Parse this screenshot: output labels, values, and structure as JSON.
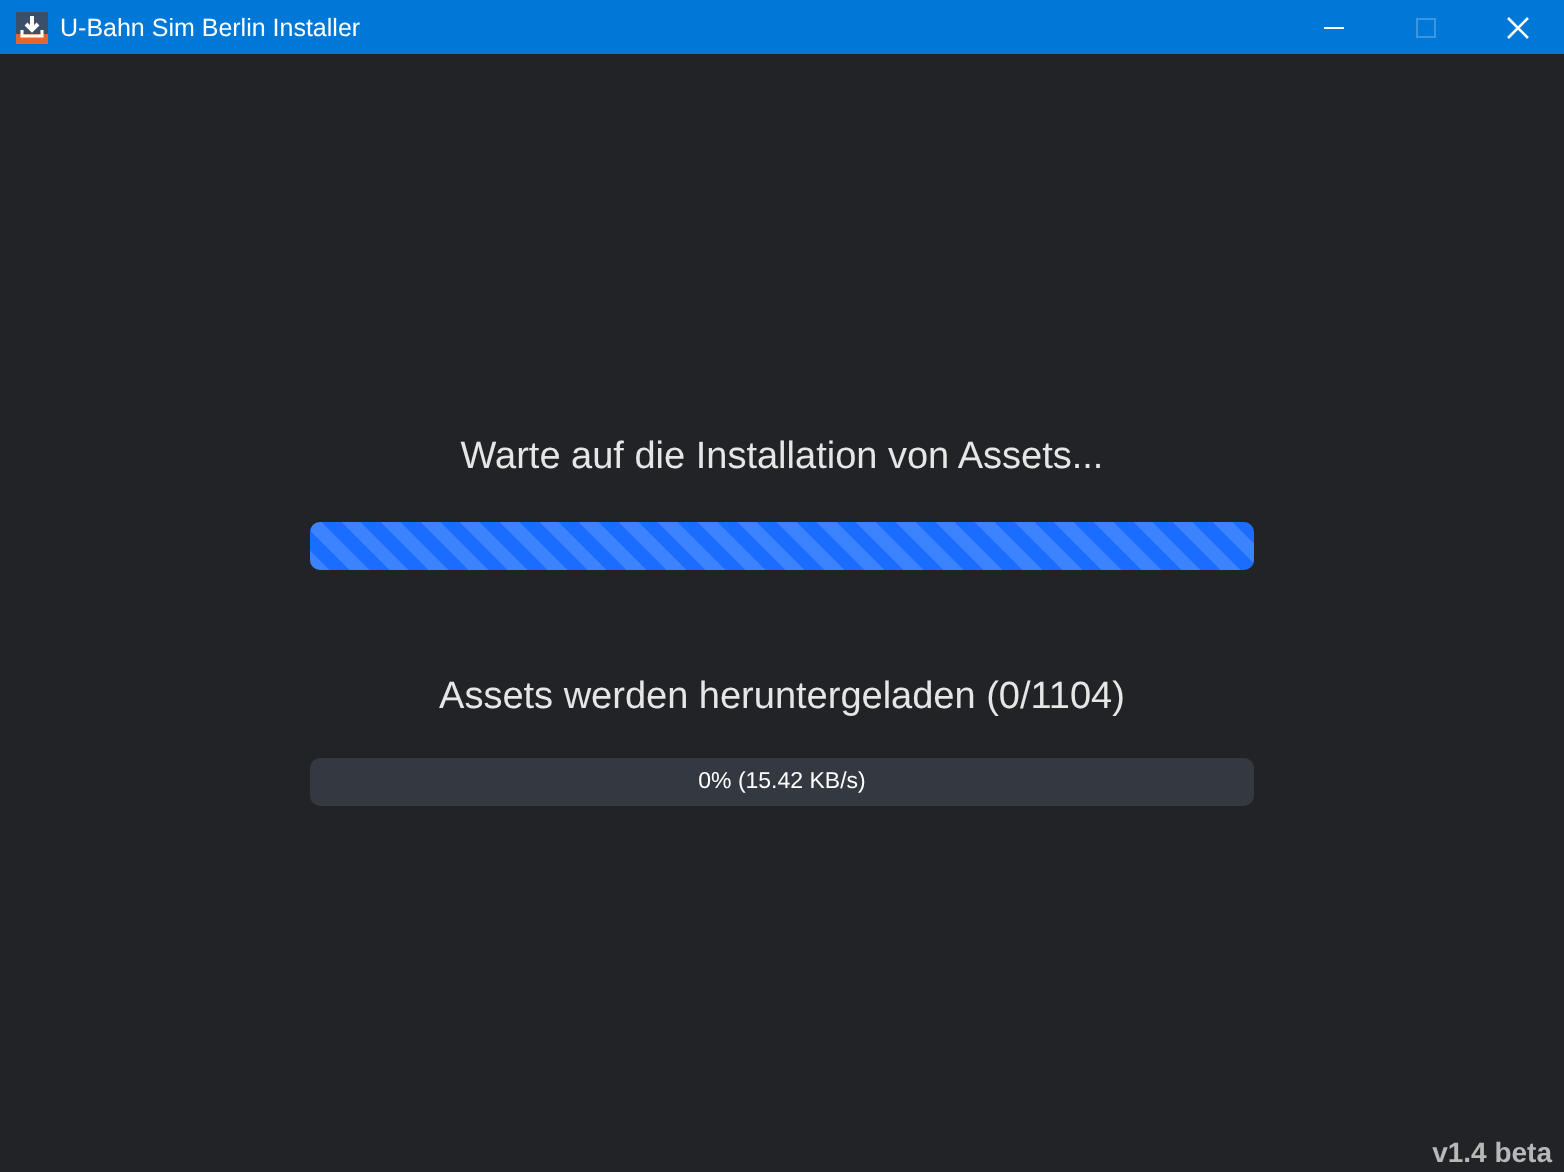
{
  "window": {
    "title": "U-Bahn Sim Berlin Installer",
    "maximize_disabled": true
  },
  "install": {
    "heading": "Warte auf die Installation von Assets...",
    "level": 1,
    "striped": true
  },
  "download": {
    "heading": "Assets werden heruntergeladen (0/1104)",
    "level": 0,
    "reading": "0% (15.42 KB/s)"
  },
  "version": "v1.4 beta"
}
